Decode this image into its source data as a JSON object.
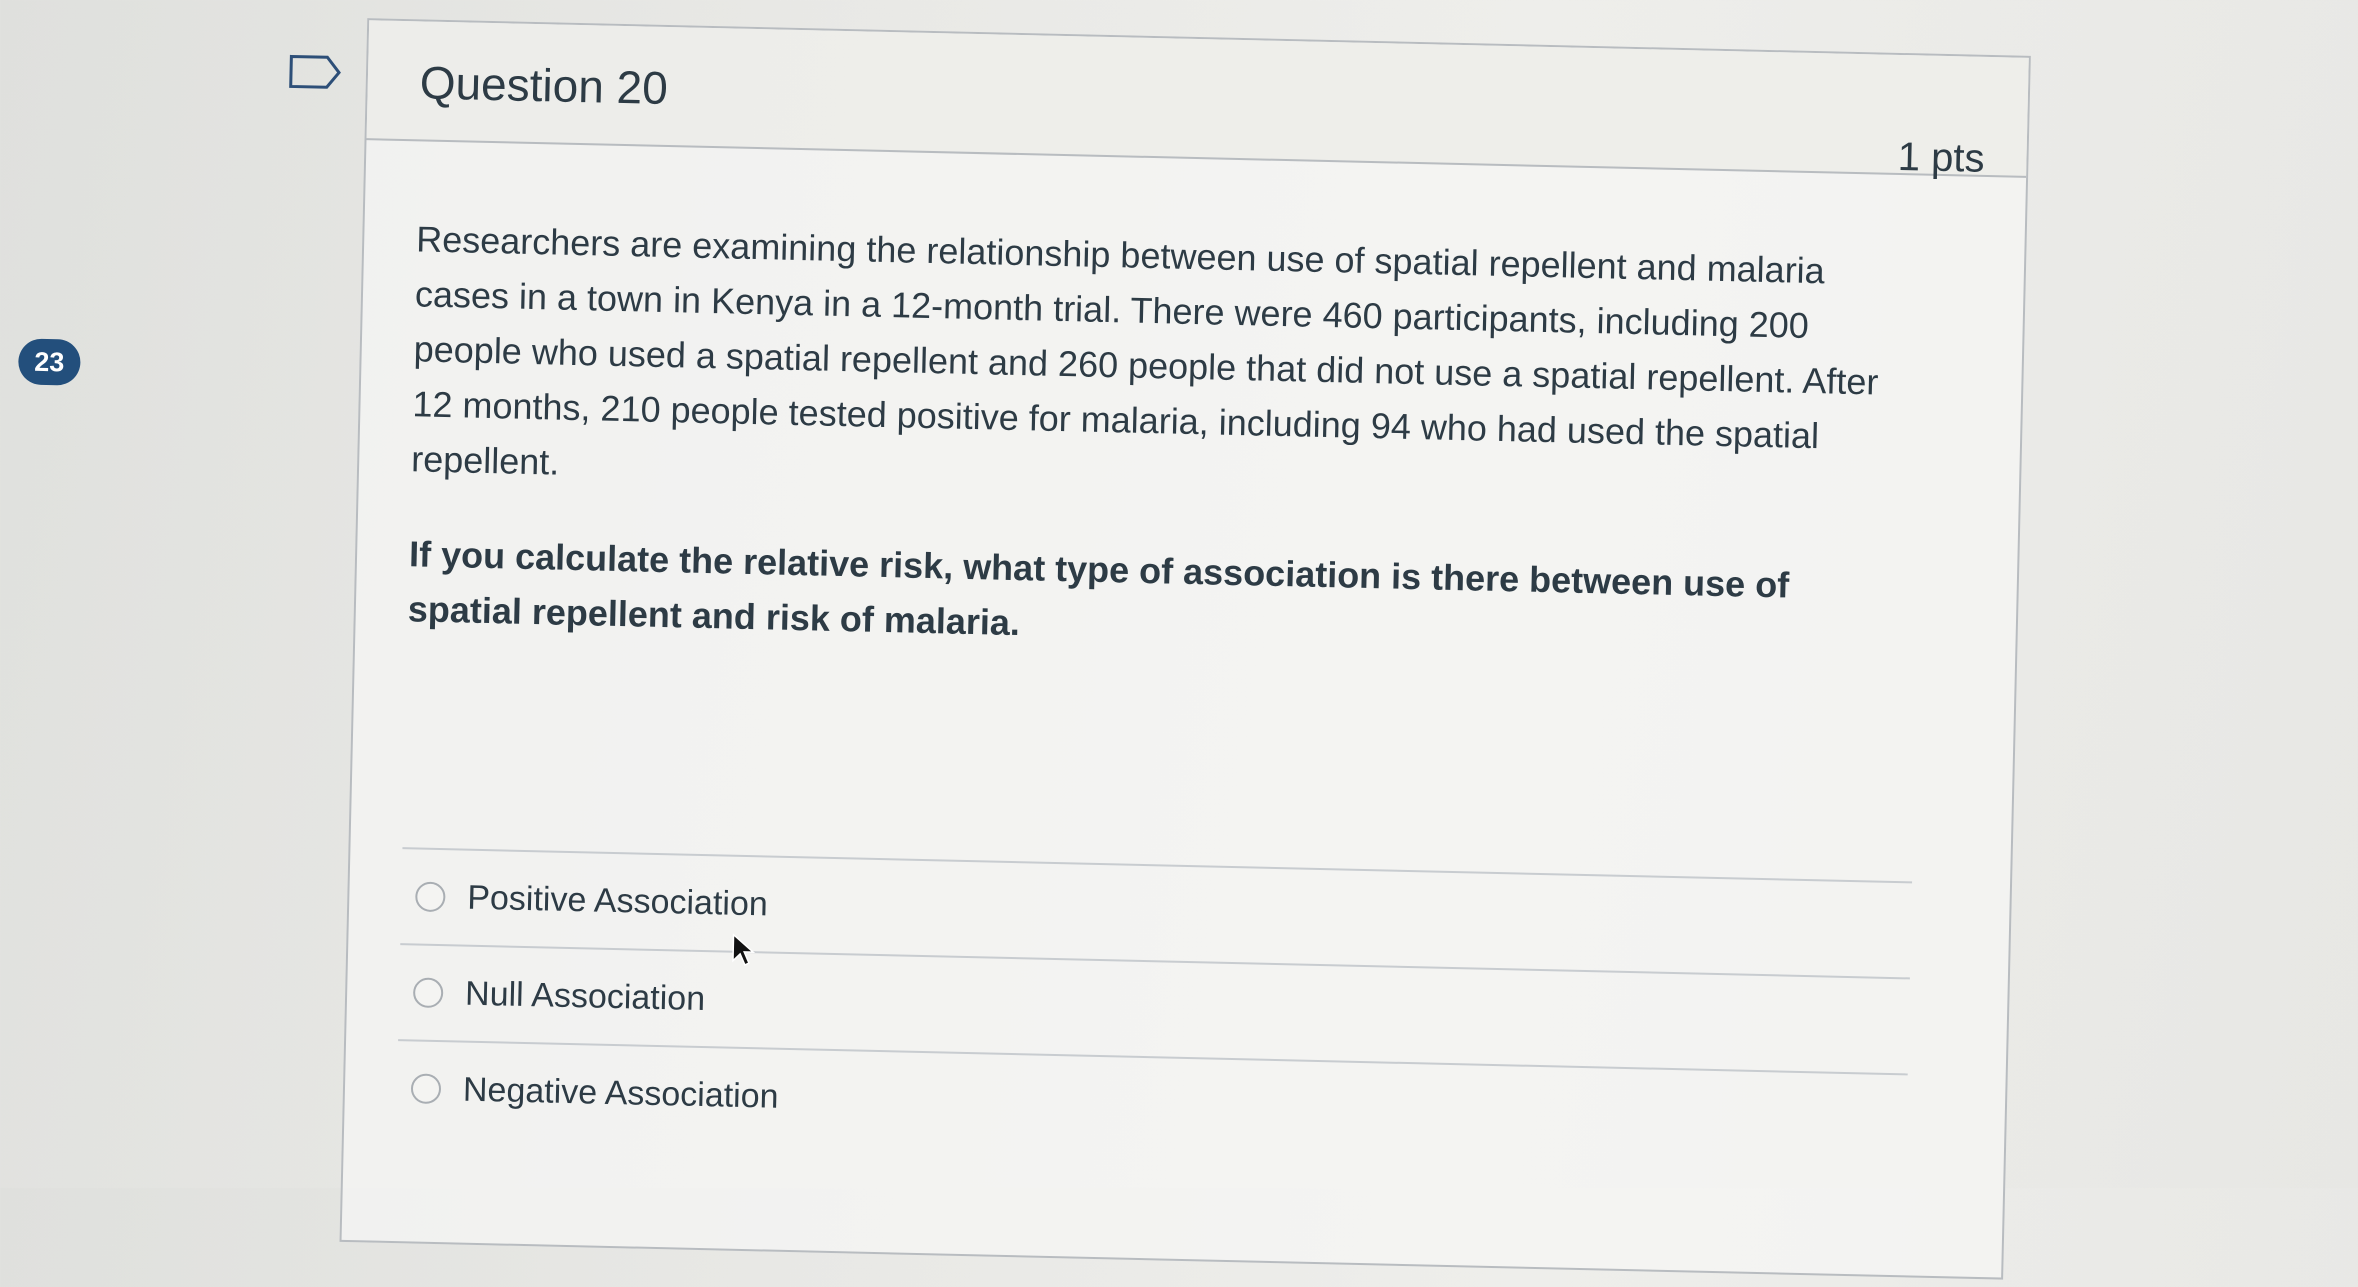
{
  "nav": {
    "question_number_badge": "23",
    "flag_icon": "flag-outline-icon"
  },
  "question": {
    "title": "Question 20",
    "points": "1 pts",
    "text": "Researchers are examining the relationship between use of spatial repellent and malaria cases in a town in Kenya in a 12-month trial. There were 460 participants, including 200 people who used a spatial repellent and 260 people that did not use a spatial repellent. After 12 months, 210 people tested positive for malaria, including 94 who had used the spatial repellent.",
    "prompt": "If you calculate the relative risk, what type of association is there between use of spatial repellent and risk of malaria."
  },
  "answers": [
    {
      "label": "Positive Association",
      "selected": false
    },
    {
      "label": "Null Association",
      "selected": false
    },
    {
      "label": "Negative Association",
      "selected": false
    }
  ],
  "colors": {
    "badge_bg": "#234f7c",
    "text": "#2d3b45",
    "border": "#b8bcc0"
  }
}
